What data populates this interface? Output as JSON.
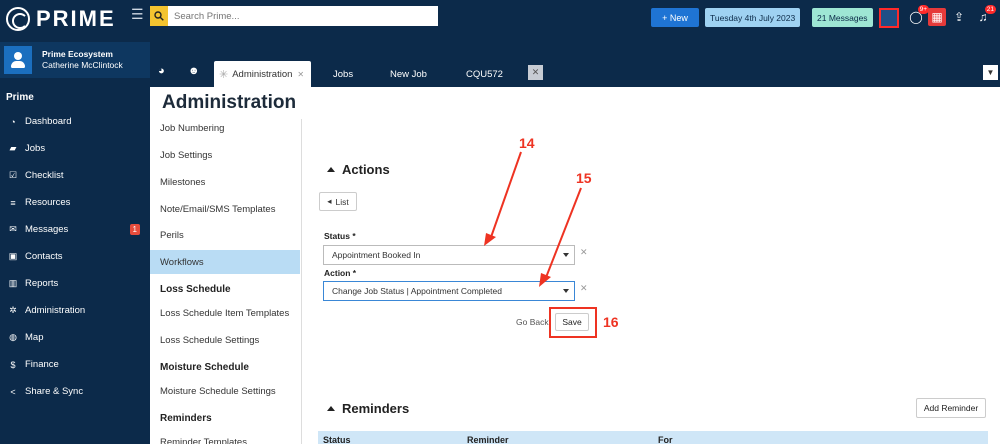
{
  "app": {
    "logo_text": "PRIME"
  },
  "user": {
    "org": "Prime Ecosystem",
    "name": "Catherine McClintock"
  },
  "sidebar": {
    "section_label": "Prime",
    "items": [
      {
        "label": "Dashboard",
        "icon": "dashboard-icon"
      },
      {
        "label": "Jobs",
        "icon": "folder-icon"
      },
      {
        "label": "Checklist",
        "icon": "checkbox-icon"
      },
      {
        "label": "Resources",
        "icon": "database-icon"
      },
      {
        "label": "Messages",
        "icon": "envelope-icon",
        "badge": "1"
      },
      {
        "label": "Contacts",
        "icon": "contact-card-icon"
      },
      {
        "label": "Reports",
        "icon": "bar-chart-icon"
      },
      {
        "label": "Administration",
        "icon": "cog-icon"
      },
      {
        "label": "Map",
        "icon": "globe-icon"
      },
      {
        "label": "Finance",
        "icon": "dollar-icon"
      },
      {
        "label": "Share & Sync",
        "icon": "share-icon"
      }
    ]
  },
  "topbar": {
    "search_placeholder": "Search Prime...",
    "new_label": "+ New",
    "date": "Tuesday 4th July 2023",
    "messages": "21 Messages",
    "chat_badge": "9+",
    "notif_badge": "21"
  },
  "tabs": {
    "active": "Administration",
    "items": [
      "Jobs",
      "New Job",
      "CQU572"
    ]
  },
  "page": {
    "title": "Administration"
  },
  "submenu": {
    "items": [
      {
        "label": "Job Numbering",
        "type": "item"
      },
      {
        "label": "Job Settings",
        "type": "item"
      },
      {
        "label": "Milestones",
        "type": "item"
      },
      {
        "label": "Note/Email/SMS Templates",
        "type": "item"
      },
      {
        "label": "Perils",
        "type": "item"
      },
      {
        "label": "Workflows",
        "type": "active"
      },
      {
        "label": "Loss Schedule",
        "type": "head"
      },
      {
        "label": "Loss Schedule Item Templates",
        "type": "item"
      },
      {
        "label": "Loss Schedule Settings",
        "type": "item"
      },
      {
        "label": "Moisture Schedule",
        "type": "head"
      },
      {
        "label": "Moisture Schedule Settings",
        "type": "item"
      },
      {
        "label": "Reminders",
        "type": "head"
      },
      {
        "label": "Reminder Templates",
        "type": "item"
      }
    ]
  },
  "actions": {
    "title": "Actions",
    "list_label": "List",
    "status_label": "Status *",
    "status_value": "Appointment Booked In",
    "action_label": "Action *",
    "action_value": "Change Job Status | Appointment Completed",
    "go_back": "Go Back",
    "save": "Save"
  },
  "reminders": {
    "title": "Reminders",
    "add_label": "Add Reminder",
    "columns": [
      "Status",
      "Reminder",
      "For"
    ]
  },
  "annotations": [
    "14",
    "15",
    "16"
  ],
  "colors": {
    "sidebar_bg": "#0c2a4a",
    "accent": "#1f74d4",
    "annotation": "#ee3322",
    "active_item": "#b9dcf4"
  }
}
